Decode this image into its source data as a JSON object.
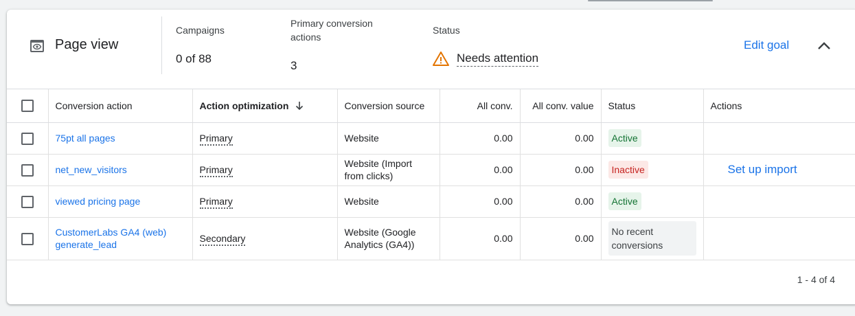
{
  "goal": {
    "title": "Page view",
    "icon": "eye-icon",
    "edit_label": "Edit goal"
  },
  "metrics": {
    "campaigns_label": "Campaigns",
    "campaigns_value": "0 of 88",
    "primary_label": "Primary conversion actions",
    "primary_value": "3",
    "status_label": "Status",
    "status_value": "Needs attention"
  },
  "colors": {
    "accent": "#1a73e8",
    "warning": "#e37400",
    "active_bg": "#e6f4ea",
    "active_text": "#137333",
    "inactive_bg": "#fce8e6",
    "inactive_text": "#c5221f"
  },
  "table": {
    "headers": [
      "Conversion action",
      "Action optimization",
      "Conversion source",
      "All conv.",
      "All conv. value",
      "Status",
      "Actions"
    ],
    "rows": [
      {
        "name": "75pt all pages",
        "optimization": "Primary",
        "source": "Website",
        "all_conv": "0.00",
        "all_conv_value": "0.00",
        "status": "Active",
        "action": ""
      },
      {
        "name": "net_new_visitors",
        "optimization": "Primary",
        "source": "Website (Import from clicks)",
        "all_conv": "0.00",
        "all_conv_value": "0.00",
        "status": "Inactive",
        "action": "Set up import"
      },
      {
        "name": "viewed pricing page",
        "optimization": "Primary",
        "source": "Website",
        "all_conv": "0.00",
        "all_conv_value": "0.00",
        "status": "Active",
        "action": ""
      },
      {
        "name": "CustomerLabs GA4 (web) generate_lead",
        "optimization": "Secondary",
        "source": "Website (Google Analytics (GA4))",
        "all_conv": "0.00",
        "all_conv_value": "0.00",
        "status": "No recent conversions",
        "action": ""
      }
    ]
  },
  "pagination": "1 - 4 of 4"
}
